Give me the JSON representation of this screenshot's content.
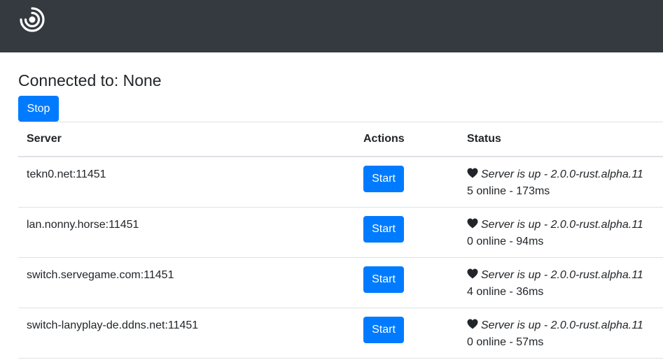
{
  "app": {
    "logo_icon": "ring-logo-icon"
  },
  "connection": {
    "label": "Connected to: None",
    "stop_label": "Stop"
  },
  "table": {
    "headers": {
      "server": "Server",
      "actions": "Actions",
      "status": "Status"
    },
    "rows": [
      {
        "server": "tekn0.net:11451",
        "action_label": "Start",
        "status_icon": "heart-icon",
        "status_text": "Server is up - 2.0.0-rust.alpha.11",
        "status_detail": "5 online - 173ms"
      },
      {
        "server": "lan.nonny.horse:11451",
        "action_label": "Start",
        "status_icon": "heart-icon",
        "status_text": "Server is up - 2.0.0-rust.alpha.11",
        "status_detail": "0 online - 94ms"
      },
      {
        "server": "switch.servegame.com:11451",
        "action_label": "Start",
        "status_icon": "heart-icon",
        "status_text": "Server is up - 2.0.0-rust.alpha.11",
        "status_detail": "4 online - 36ms"
      },
      {
        "server": "switch-lanyplay-de.ddns.net:11451",
        "action_label": "Start",
        "status_icon": "heart-icon",
        "status_text": "Server is up - 2.0.0-rust.alpha.11",
        "status_detail": "0 online - 57ms"
      }
    ]
  },
  "colors": {
    "navbar": "#343a40",
    "primary": "#007bff",
    "border": "#dee2e6",
    "text": "#212529"
  }
}
